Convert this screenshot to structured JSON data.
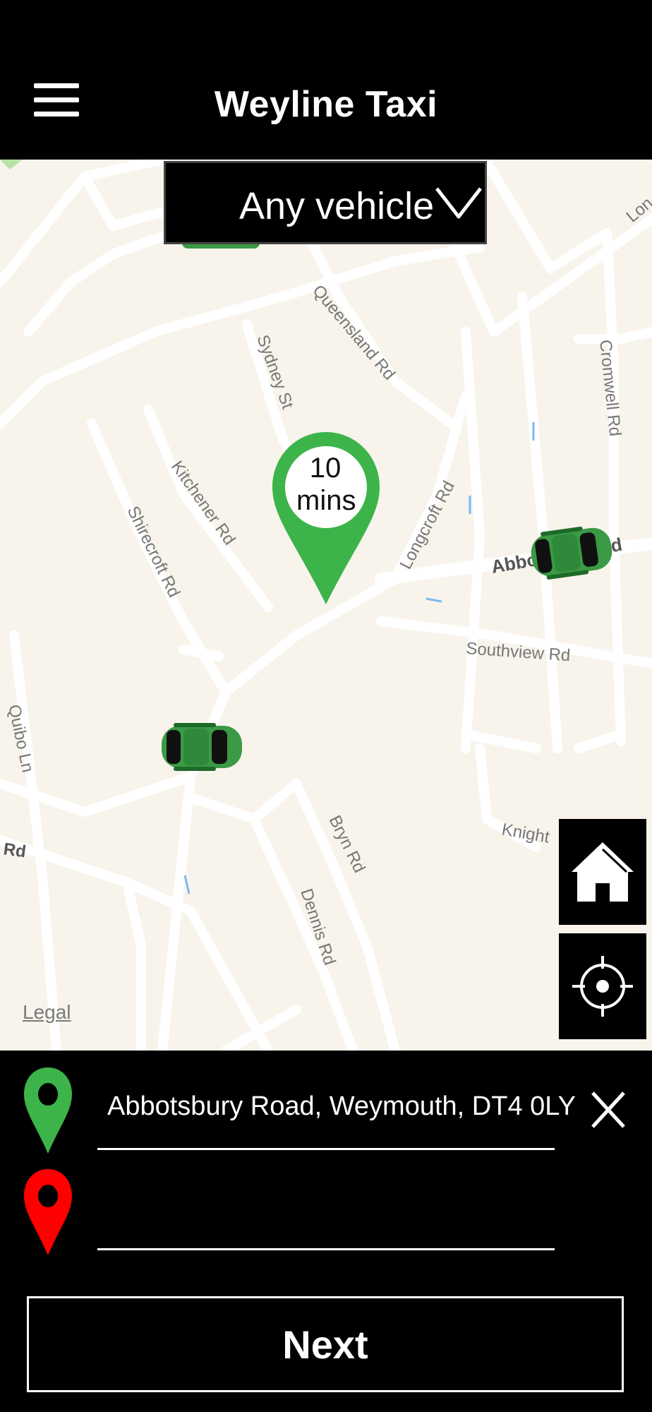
{
  "header": {
    "title": "Weyline Taxi",
    "menu_icon": "hamburger-menu-icon"
  },
  "vehicle_selector": {
    "label": "Any vehicle",
    "icon": "chevron-down-icon"
  },
  "eta_marker": {
    "line1": "10",
    "line2": "mins",
    "color": "#3cb44a"
  },
  "map": {
    "legal_link": "Legal",
    "street_labels": [
      "Queensland Rd",
      "Sydney St",
      "Cromwell Rd",
      "Kitchener Rd",
      "Longcroft Rd",
      "Shirecroft Rd",
      "Abbotsbury Rd",
      "Southview Rd",
      "Quibo Ln",
      "Bryn Rd",
      "Dennis Rd",
      "Knight",
      "Rd",
      "Lon"
    ]
  },
  "map_controls": {
    "home_icon": "home-icon",
    "locate_icon": "locate-crosshair-icon"
  },
  "trip": {
    "pickup_value": "Abbotsbury Road, Weymouth, DT4 0LY",
    "pickup_icon_color": "#3cb44a",
    "dropoff_value": "",
    "dropoff_icon_color": "#ff0000",
    "clear_icon": "close-icon"
  },
  "actions": {
    "next_label": "Next"
  },
  "colors": {
    "accent_green": "#3cb44a",
    "map_bg": "#f8f4ec",
    "road": "#ffffff"
  }
}
